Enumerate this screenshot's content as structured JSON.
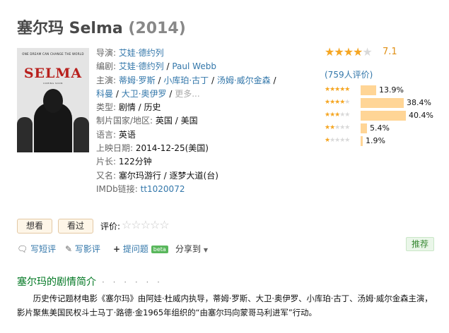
{
  "title": {
    "name": "塞尔玛 Selma",
    "year": "(2014)"
  },
  "poster": {
    "tagline": "ONE DREAM CAN CHANGE THE WORLD",
    "movie_title": "SELMA",
    "sub": "COMING SOON"
  },
  "info": {
    "director_label": "导演: ",
    "director": "艾娃·德约列",
    "writer_label": "编剧: ",
    "writers": [
      "艾娃·德约列",
      "Paul Webb"
    ],
    "cast_label": "主演: ",
    "cast": [
      "蒂姆·罗斯",
      "小库珀·古丁",
      "汤姆·威尔金森",
      "科曼",
      "大卫·奥伊罗"
    ],
    "cast_more": "更多...",
    "genre_label": "类型: ",
    "genre": "剧情 / 历史",
    "country_label": "制片国家/地区: ",
    "country": "英国 / 美国",
    "language_label": "语言: ",
    "language": "英语",
    "release_label": "上映日期: ",
    "release": "2014-12-25(美国)",
    "runtime_label": "片长: ",
    "runtime": "122分钟",
    "aka_label": "又名: ",
    "aka": "塞尔玛游行 / 逐梦大道(台)",
    "imdb_label": "IMDb链接: ",
    "imdb": "tt1020072"
  },
  "rating": {
    "score": "7.1",
    "stars_value": 3.5,
    "count_text": "(759人评价)",
    "distribution": [
      {
        "stars": 5,
        "percent": 13.9,
        "label": "13.9%"
      },
      {
        "stars": 4,
        "percent": 38.4,
        "label": "38.4%"
      },
      {
        "stars": 3,
        "percent": 40.4,
        "label": "40.4%"
      },
      {
        "stars": 2,
        "percent": 5.4,
        "label": "5.4%"
      },
      {
        "stars": 1,
        "percent": 1.9,
        "label": "1.9%"
      }
    ]
  },
  "user_actions": {
    "want_label": "想看",
    "seen_label": "看过",
    "rate_label": "评价:"
  },
  "actions": {
    "short_review": "写短评",
    "review": "写影评",
    "question": "提问题",
    "beta": "beta",
    "share": "分享到",
    "recommend": "推荐"
  },
  "icons": {
    "comment": "comment-icon",
    "pencil": "pencil-icon",
    "plus": "plus-icon",
    "dropdown": "dropdown-icon",
    "star": "star-icon"
  },
  "colors": {
    "link": "#3377aa",
    "star": "#f5a623",
    "bar": "#ffd596",
    "section_title": "#007722"
  },
  "synopsis": {
    "title": "塞尔玛的剧情简介",
    "dots": "· · · · · ·",
    "text": "历史传记题材电影《塞尔玛》由阿娃·杜威内执导，蒂姆·罗斯、大卫·奥伊罗、小库珀·古丁、汤姆·威尔金森主演，影片聚焦美国民权斗士马丁·路德·金1965年组织的“由塞尔玛向蒙哥马利进军”行动。"
  }
}
